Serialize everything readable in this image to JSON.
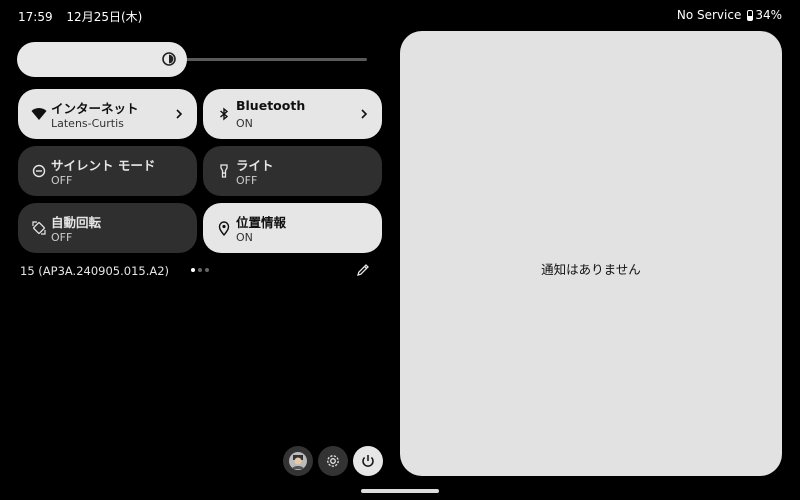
{
  "status_bar": {
    "time": "17:59",
    "date": "12月25日(木)",
    "network": "No Service",
    "battery": "34%"
  },
  "brightness": {
    "level": 0.46
  },
  "tiles": [
    {
      "title": "インターネット",
      "subtitle": "Latens-Curtis",
      "state": "on",
      "icon": "wifi-icon",
      "has_chevron": true
    },
    {
      "title": "Bluetooth",
      "subtitle": "ON",
      "state": "on",
      "icon": "bluetooth-icon",
      "has_chevron": true
    },
    {
      "title": "サイレント モード",
      "subtitle": "OFF",
      "state": "off",
      "icon": "do-not-disturb-icon",
      "has_chevron": false
    },
    {
      "title": "ライト",
      "subtitle": "OFF",
      "state": "off",
      "icon": "flashlight-icon",
      "has_chevron": false
    },
    {
      "title": "自動回転",
      "subtitle": "OFF",
      "state": "off",
      "icon": "auto-rotate-icon",
      "has_chevron": false
    },
    {
      "title": "位置情報",
      "subtitle": "ON",
      "state": "on",
      "icon": "location-icon",
      "has_chevron": false
    }
  ],
  "build_number": "15 (AP3A.240905.015.A2)",
  "page_indicator": {
    "pages": 3,
    "current": 1
  },
  "notifications": {
    "empty_text": "通知はありません"
  },
  "bottom_buttons": [
    "user-icon",
    "settings-gear-icon",
    "power-icon"
  ],
  "colors": {
    "tile_on": "#e6e6e6",
    "tile_off": "#2f2f2f",
    "panel": "#e2e2e2",
    "background": "#000000"
  }
}
